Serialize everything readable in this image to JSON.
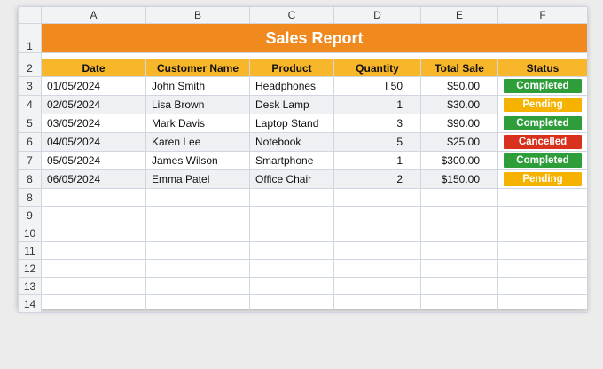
{
  "columns": [
    "A",
    "B",
    "C",
    "D",
    "E",
    "F"
  ],
  "row_numbers": [
    "1",
    "2",
    "3",
    "4",
    "5",
    "6",
    "7",
    "8",
    "9",
    "10",
    "11",
    "12",
    "13",
    "14"
  ],
  "title": "Sales Report",
  "headers": {
    "date": "Date",
    "customer": "Customer Name",
    "product": "Product",
    "quantity": "Quantity",
    "total": "Total Sale",
    "status": "Status"
  },
  "rows": [
    {
      "date": "01/05/2024",
      "customer": "John Smith",
      "product": "Headphones",
      "quantity": "I 50",
      "total": "$50.00",
      "status": "Completed"
    },
    {
      "date": "02/05/2024",
      "customer": "Lisa Brown",
      "product": "Desk Lamp",
      "quantity": "1",
      "total": "$30.00",
      "status": "Pending"
    },
    {
      "date": "03/05/2024",
      "customer": "Mark Davis",
      "product": "Laptop Stand",
      "quantity": "3",
      "total": "$90.00",
      "status": "Completed"
    },
    {
      "date": "04/05/2024",
      "customer": "Karen Lee",
      "product": "Notebook",
      "quantity": "5",
      "total": "$25.00",
      "status": "Cancelled"
    },
    {
      "date": "05/05/2024",
      "customer": "James Wilson",
      "product": "Smartphone",
      "quantity": "1",
      "total": "$300.00",
      "status": "Completed"
    },
    {
      "date": "06/05/2024",
      "customer": "Emma Patel",
      "product": "Office Chair",
      "quantity": "2",
      "total": "$150.00",
      "status": "Pending"
    }
  ],
  "status_colors": {
    "Completed": "#2e9e3a",
    "Pending": "#f5b300",
    "Cancelled": "#d8321e"
  },
  "colors": {
    "title_bg": "#f08a1f",
    "header_bg": "#f8b62a"
  }
}
